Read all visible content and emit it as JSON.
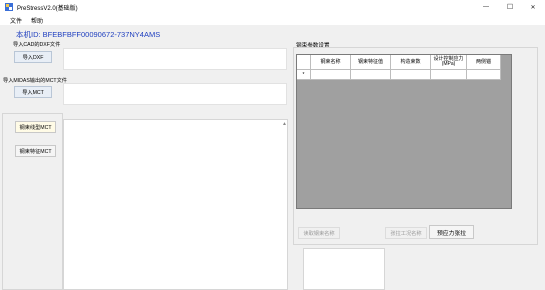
{
  "window": {
    "title": "PreStressV2.0(基础版)",
    "minimize_glyph": "—",
    "maximize_glyph": "☐",
    "close_glyph": "✕"
  },
  "menu": {
    "items": [
      "文件",
      "帮助"
    ]
  },
  "machine": {
    "id_text": "本机ID:  BFEBFBFF00090672-737NY4AMS"
  },
  "left": {
    "cad_label": "导入CAD的DXF文件",
    "dxf_button": "导入DXF",
    "midas_label": "导入MIDAS输出的MCT文件",
    "mct_button": "导入MCT",
    "gen_bundle_button": "钢束线型MCT",
    "gen_feature_button": "钢束特征MCT"
  },
  "right": {
    "settings_label": "钢束参数设置",
    "columns": [
      "钢束名称",
      "钢束特征值",
      "构造束数",
      "设计控制应力(MPa)",
      "两侧锚"
    ],
    "new_row_marker": "*",
    "read_button": "读取钢束名称",
    "tension_name_button": "张拉工况名称",
    "prestress_button": "预应力张拉"
  },
  "colors": {
    "title_text": "#1f3fbf",
    "grid_bg": "#a0a0a0"
  }
}
